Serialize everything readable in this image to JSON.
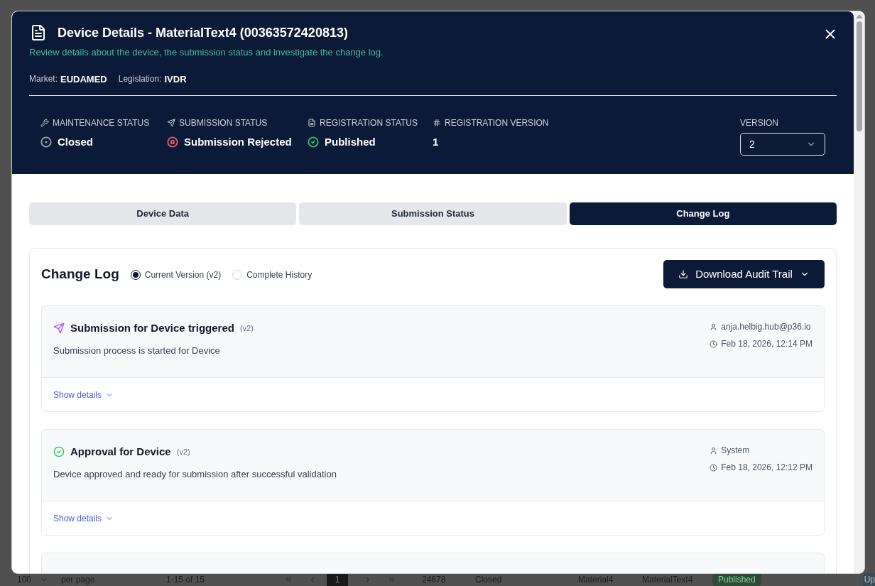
{
  "dialog": {
    "title": "Device Details - MaterialText4 (00363572420813)",
    "subtitle": "Review details about the device, the submission status and investigate the change log.",
    "meta": [
      {
        "label": "Market:",
        "value": "EUDAMED"
      },
      {
        "label": "Legislation:",
        "value": "IVDR"
      }
    ],
    "statuses": [
      {
        "kind": "maintenance",
        "label": "MAINTENANCE STATUS",
        "value": "Closed",
        "color": "#9aa3b2"
      },
      {
        "kind": "submission",
        "label": "SUBMISSION STATUS",
        "value": "Submission Rejected",
        "color": "#f0556a"
      },
      {
        "kind": "registration",
        "label": "REGISTRATION STATUS",
        "value": "Published",
        "color": "#30c46c"
      },
      {
        "kind": "version",
        "label": "REGISTRATION VERSION",
        "value": "1"
      }
    ],
    "version": {
      "label": "VERSION",
      "value": "2"
    }
  },
  "tabs": [
    {
      "label": "Device Data",
      "selected": false
    },
    {
      "label": "Submission Status",
      "selected": false
    },
    {
      "label": "Change Log",
      "selected": true
    }
  ],
  "change_log": {
    "title": "Change Log",
    "filters": [
      {
        "label": "Current Version (v2)",
        "selected": true
      },
      {
        "label": "Complete History",
        "selected": false
      }
    ],
    "download_button": "Download Audit Trail",
    "entries": [
      {
        "kind": "submission",
        "title": "Submission for Device triggered",
        "version": "(v2)",
        "description": "Submission process is started for Device",
        "user": "anja.helbig.hub@p36.io",
        "time": "Feb 18, 2026, 12:14 PM",
        "details_link": "Show details"
      },
      {
        "kind": "approval",
        "title": "Approval for Device",
        "version": "(v2)",
        "description": "Device approved and ready for submission after successful validation",
        "user": "System",
        "time": "Feb 18, 2026, 12:12 PM",
        "details_link": "Show details"
      }
    ]
  },
  "background_footer": {
    "page_size": "100",
    "per_page": "per page",
    "range": "1-15 of 15",
    "page": "1",
    "cells": [
      "24678",
      "Closed",
      "Material4",
      "MaterialText4"
    ],
    "status": "Published",
    "last_cell": "Up"
  }
}
